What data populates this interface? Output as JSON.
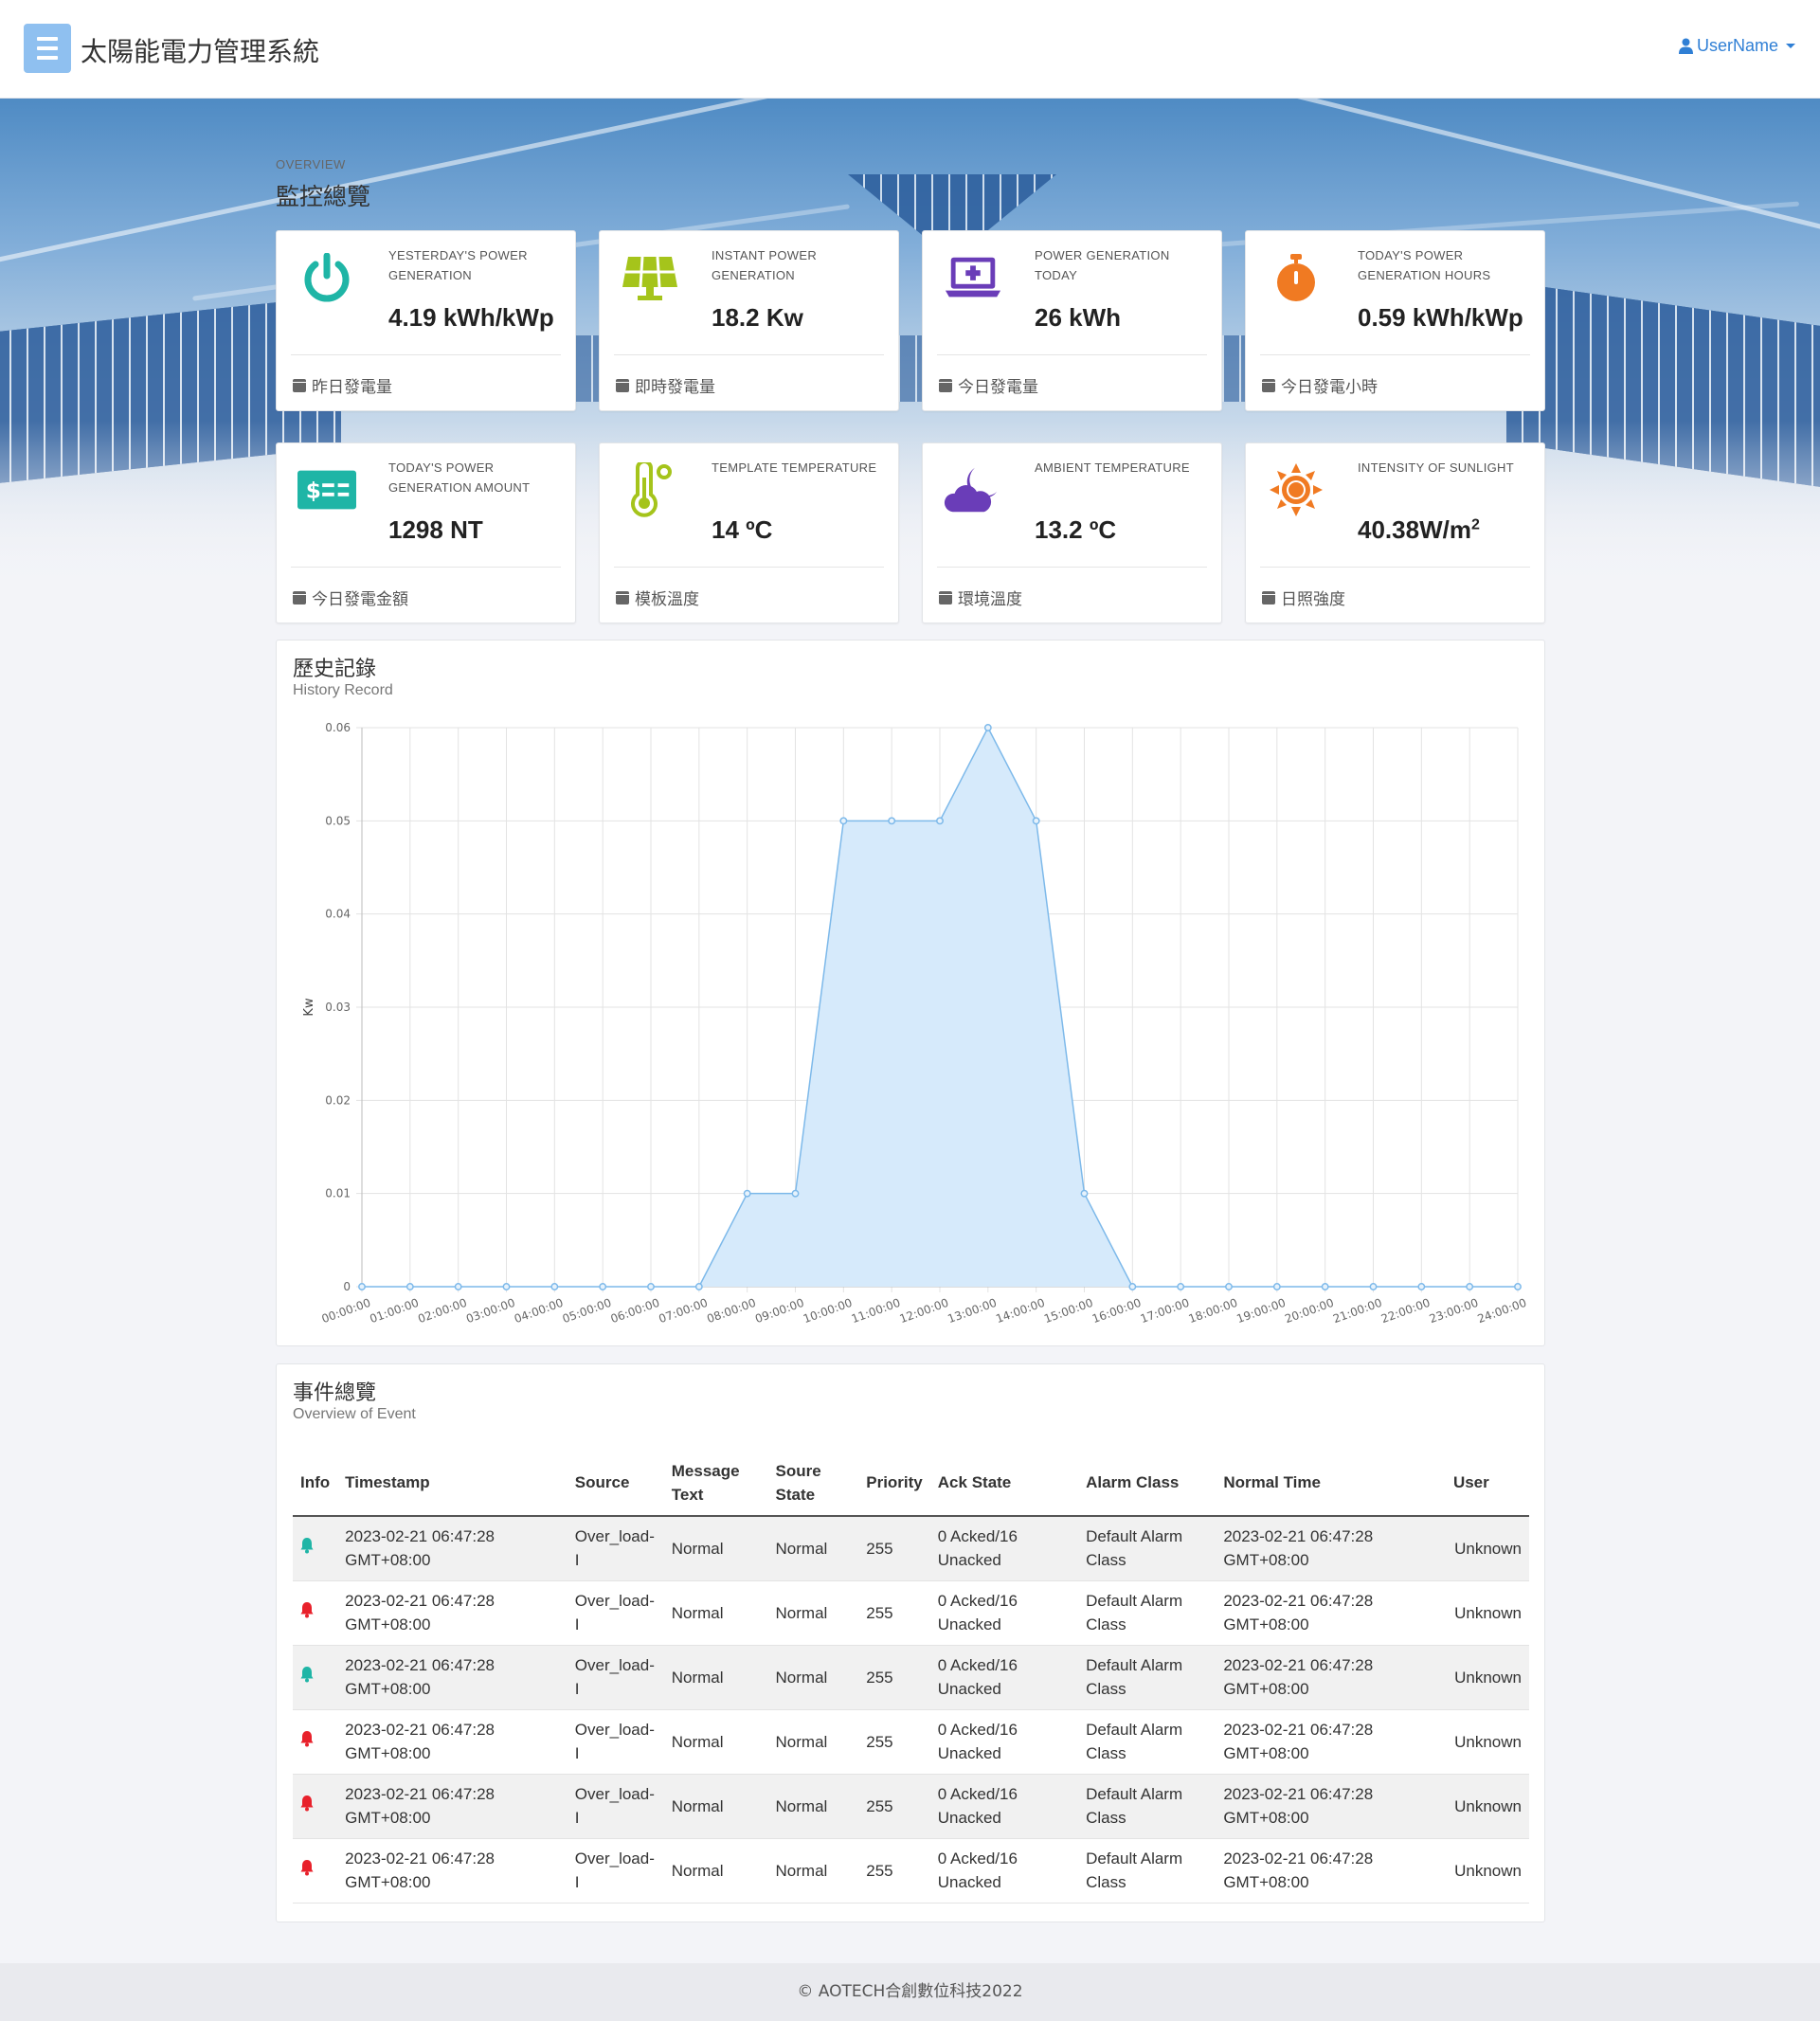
{
  "header": {
    "app_title": "太陽能電力管理系統",
    "user_name": "UserName"
  },
  "overview": {
    "small_label": "OVERVIEW",
    "title": "監控總覽"
  },
  "cards": [
    {
      "label": "YESTERDAY'S POWER GENERATION",
      "value": "4.19 kWh/kWp",
      "footer": "昨日發電量",
      "icon": "power-icon",
      "color": "#1fb5a6"
    },
    {
      "label": "INSTANT POWER GENERATION",
      "value": "18.2 Kw",
      "footer": "即時發電量",
      "icon": "solar-panel-icon",
      "color": "#a5c41b"
    },
    {
      "label": "POWER GENERATION TODAY",
      "value": "26 kWh",
      "footer": "今日發電量",
      "icon": "laptop-plus-icon",
      "color": "#6a3db8"
    },
    {
      "label": "TODAY'S POWER GENERATION HOURS",
      "value": "0.59 kWh/kWp",
      "footer": "今日發電小時",
      "icon": "stopwatch-icon",
      "color": "#f07a22"
    },
    {
      "label": "TODAY'S POWER GENERATION AMOUNT",
      "value": "1298 NT",
      "footer": "今日發電金額",
      "icon": "money-icon",
      "color": "#1fb5a6"
    },
    {
      "label": "TEMPLATE TEMPERATURE",
      "value": "14 ºC",
      "footer": "模板溫度",
      "icon": "thermometer-icon",
      "color": "#a5c41b"
    },
    {
      "label": "AMBIENT TEMPERATURE",
      "value": "13.2 ºC",
      "footer": "環境溫度",
      "icon": "cloud-moon-icon",
      "color": "#6a3db8"
    },
    {
      "label": "INTENSITY OF SUNLIGHT",
      "value": "40.38W/m",
      "value_sup": "2",
      "footer": "日照強度",
      "icon": "sun-icon",
      "color": "#f07a22"
    }
  ],
  "history": {
    "title": "歷史記錄",
    "subtitle": "History Record"
  },
  "chart_data": {
    "type": "area",
    "ylabel": "Kw",
    "xlabel": "",
    "ylim": [
      0,
      0.06
    ],
    "yticks": [
      "0",
      "0.01",
      "0.02",
      "0.03",
      "0.04",
      "0.05",
      "0.06"
    ],
    "x": [
      "00:00:00",
      "01:00:00",
      "02:00:00",
      "03:00:00",
      "04:00:00",
      "05:00:00",
      "06:00:00",
      "07:00:00",
      "08:00:00",
      "09:00:00",
      "10:00:00",
      "11:00:00",
      "12:00:00",
      "13:00:00",
      "14:00:00",
      "15:00:00",
      "16:00:00",
      "17:00:00",
      "18:00:00",
      "19:00:00",
      "20:00:00",
      "21:00:00",
      "22:00:00",
      "23:00:00",
      "24:00:00"
    ],
    "series": [
      {
        "values": [
          0,
          0,
          0,
          0,
          0,
          0,
          0,
          0,
          0.01,
          0.01,
          0.05,
          0.05,
          0.05,
          0.06,
          0.05,
          0.01,
          0,
          0,
          0,
          0,
          0,
          0,
          0,
          0,
          0
        ],
        "color": "#7db9ea",
        "fill": "#d6eafb"
      }
    ],
    "grid": true
  },
  "events": {
    "title": "事件總覽",
    "subtitle": "Overview of Event",
    "columns": [
      "Info",
      "Timestamp",
      "Source",
      "Message Text",
      "Soure State",
      "Priority",
      "Ack State",
      "Alarm Class",
      "Normal Time",
      "User"
    ],
    "rows": [
      {
        "bell_color": "#1fb5a6",
        "timestamp": "2023-02-21 06:47:28 GMT+08:00",
        "source": "Over_load-I",
        "message": "Normal",
        "state": "Normal",
        "priority": "255",
        "ack": "0 Acked/16 Unacked",
        "alarm_class": "Default Alarm Class",
        "normal_time": "2023-02-21 06:47:28 GMT+08:00",
        "user": "Unknown"
      },
      {
        "bell_color": "#e8212b",
        "timestamp": "2023-02-21 06:47:28 GMT+08:00",
        "source": "Over_load-I",
        "message": "Normal",
        "state": "Normal",
        "priority": "255",
        "ack": "0 Acked/16 Unacked",
        "alarm_class": "Default Alarm Class",
        "normal_time": "2023-02-21 06:47:28 GMT+08:00",
        "user": "Unknown"
      },
      {
        "bell_color": "#1fb5a6",
        "timestamp": "2023-02-21 06:47:28 GMT+08:00",
        "source": "Over_load-I",
        "message": "Normal",
        "state": "Normal",
        "priority": "255",
        "ack": "0 Acked/16 Unacked",
        "alarm_class": "Default Alarm Class",
        "normal_time": "2023-02-21 06:47:28 GMT+08:00",
        "user": "Unknown"
      },
      {
        "bell_color": "#e8212b",
        "timestamp": "2023-02-21 06:47:28 GMT+08:00",
        "source": "Over_load-I",
        "message": "Normal",
        "state": "Normal",
        "priority": "255",
        "ack": "0 Acked/16 Unacked",
        "alarm_class": "Default Alarm Class",
        "normal_time": "2023-02-21 06:47:28 GMT+08:00",
        "user": "Unknown"
      },
      {
        "bell_color": "#e8212b",
        "timestamp": "2023-02-21 06:47:28 GMT+08:00",
        "source": "Over_load-I",
        "message": "Normal",
        "state": "Normal",
        "priority": "255",
        "ack": "0 Acked/16 Unacked",
        "alarm_class": "Default Alarm Class",
        "normal_time": "2023-02-21 06:47:28 GMT+08:00",
        "user": "Unknown"
      },
      {
        "bell_color": "#e8212b",
        "timestamp": "2023-02-21 06:47:28 GMT+08:00",
        "source": "Over_load-I",
        "message": "Normal",
        "state": "Normal",
        "priority": "255",
        "ack": "0 Acked/16 Unacked",
        "alarm_class": "Default Alarm Class",
        "normal_time": "2023-02-21 06:47:28 GMT+08:00",
        "user": "Unknown"
      }
    ]
  },
  "footer": {
    "text": "© AOTECH合創數位科技2022"
  }
}
